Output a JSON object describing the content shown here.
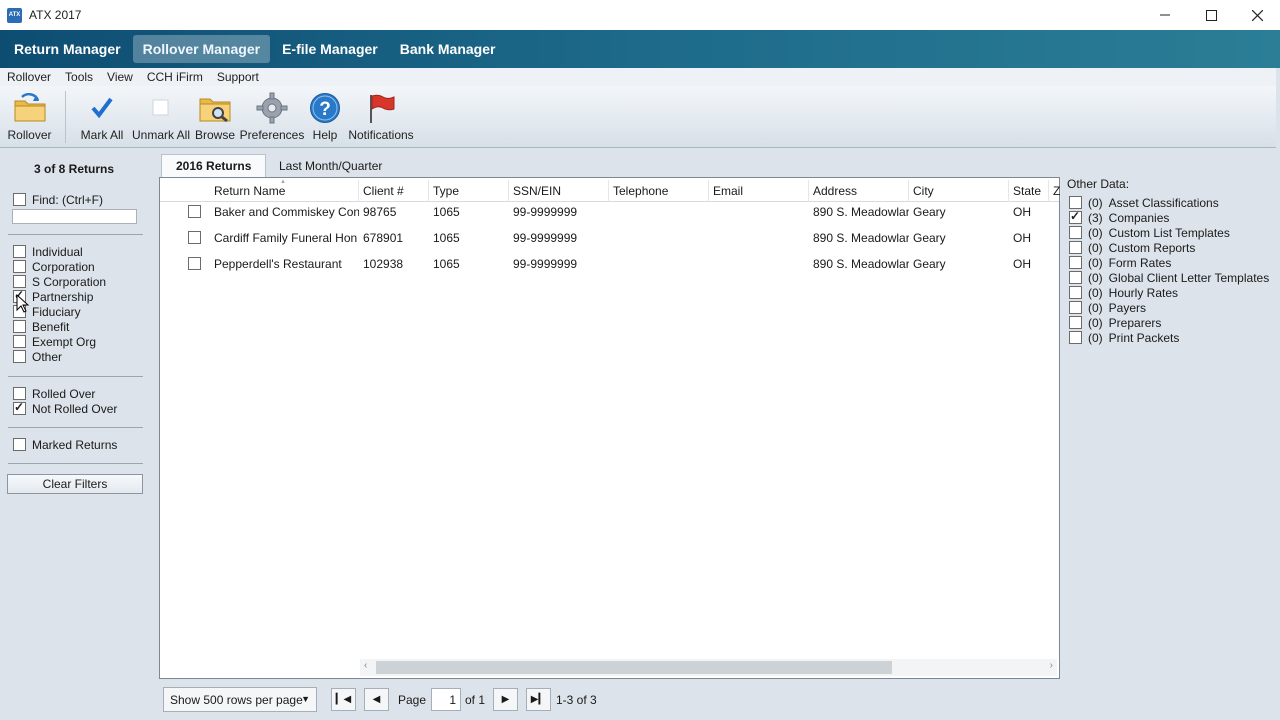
{
  "window": {
    "title": "ATX 2017",
    "icon_text": "ATX"
  },
  "nav": {
    "tabs": [
      "Return Manager",
      "Rollover Manager",
      "E-file Manager",
      "Bank Manager"
    ],
    "active": "Rollover Manager"
  },
  "menu": [
    "Rollover",
    "Tools",
    "View",
    "CCH iFirm",
    "Support"
  ],
  "toolbar": {
    "rollover": "Rollover",
    "mark_all": "Mark All",
    "unmark_all": "Unmark All",
    "browse": "Browse",
    "preferences": "Preferences",
    "help": "Help",
    "notifications": "Notifications"
  },
  "left": {
    "count": "3 of 8  Returns",
    "find_label": "Find: (Ctrl+F)",
    "find_value": "",
    "types": [
      {
        "label": "Individual",
        "checked": false
      },
      {
        "label": "Corporation",
        "checked": false
      },
      {
        "label": "S Corporation",
        "checked": false
      },
      {
        "label": "Partnership",
        "checked": true
      },
      {
        "label": "Fiduciary",
        "checked": false
      },
      {
        "label": "Benefit",
        "checked": false
      },
      {
        "label": "Exempt Org",
        "checked": false
      },
      {
        "label": "Other",
        "checked": false
      }
    ],
    "rolled_over": "Rolled Over",
    "not_rolled_over": "Not Rolled Over",
    "marked_returns": "Marked Returns",
    "clear_filters": "Clear Filters"
  },
  "return_tabs": [
    "2016 Returns",
    "Last Month/Quarter"
  ],
  "grid": {
    "columns": [
      "Return Name",
      "Client #",
      "Type",
      "SSN/EIN",
      "Telephone",
      "Email",
      "Address",
      "City",
      "State",
      "Z"
    ],
    "rows": [
      [
        "Baker and Commiskey Con",
        "98765",
        "1065",
        "99-9999999",
        "",
        "",
        "890 S. Meadowlar",
        "Geary",
        "OH"
      ],
      [
        "Cardiff Family Funeral Hon",
        "678901",
        "1065",
        "99-9999999",
        "",
        "",
        "890 S. Meadowlar",
        "Geary",
        "OH"
      ],
      [
        "Pepperdell's Restaurant",
        "102938",
        "1065",
        "99-9999999",
        "",
        "",
        "890 S. Meadowlar",
        "Geary",
        "OH"
      ]
    ]
  },
  "pager": {
    "rows_per_page": "Show 500 rows per page",
    "page_label": "Page",
    "page": "1",
    "of": "of 1",
    "range": "1-3 of 3"
  },
  "other_data": {
    "title": "Other Data:",
    "items": [
      {
        "count": "(0)",
        "name": "Asset Classifications",
        "checked": false
      },
      {
        "count": "(3)",
        "name": "Companies",
        "checked": true
      },
      {
        "count": "(0)",
        "name": "Custom List Templates",
        "checked": false
      },
      {
        "count": "(0)",
        "name": "Custom Reports",
        "checked": false
      },
      {
        "count": "(0)",
        "name": "Form Rates",
        "checked": false
      },
      {
        "count": "(0)",
        "name": "Global Client Letter Templates",
        "checked": false
      },
      {
        "count": "(0)",
        "name": "Hourly Rates",
        "checked": false
      },
      {
        "count": "(0)",
        "name": "Payers",
        "checked": false
      },
      {
        "count": "(0)",
        "name": "Preparers",
        "checked": false
      },
      {
        "count": "(0)",
        "name": "Print Packets",
        "checked": false
      }
    ]
  },
  "colors": {
    "nav_start": "#0e4d72",
    "nav_end": "#2b7e96",
    "panel_bg": "#dde3ea",
    "help_blue": "#2a78c8",
    "flag_red": "#d9362b"
  }
}
